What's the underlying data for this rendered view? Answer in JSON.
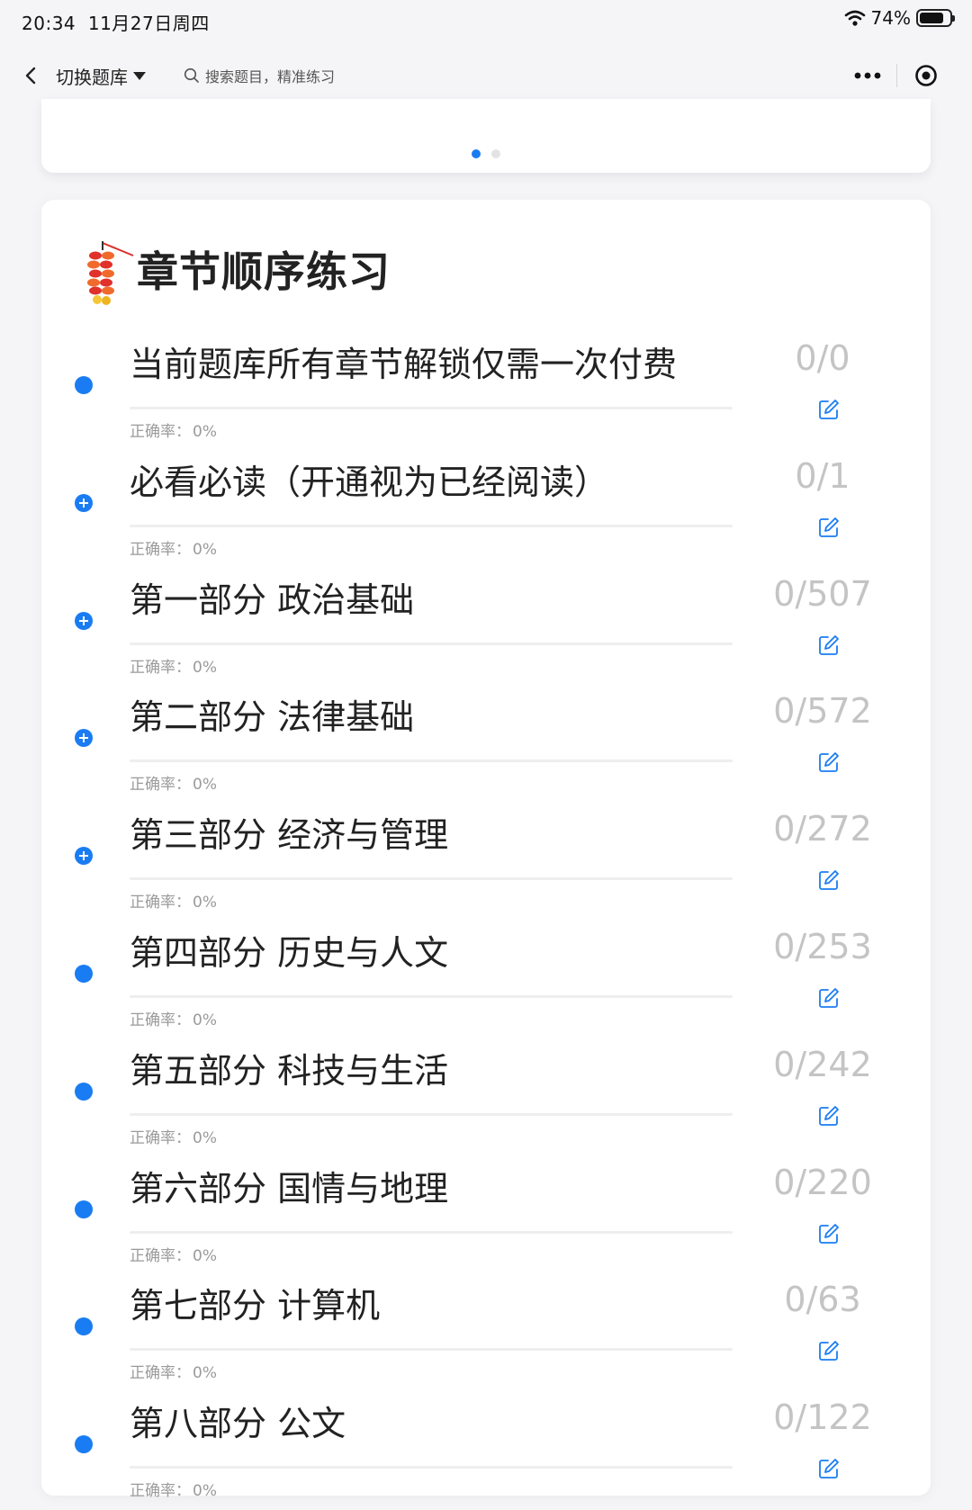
{
  "status_bar": {
    "time": "20:34",
    "date": "11月27日周四",
    "battery": "74%"
  },
  "nav": {
    "switch_bank": "切换题库",
    "search_placeholder": "搜索题目，精准练习"
  },
  "carousel": {
    "pages": 2,
    "active": 0
  },
  "section": {
    "title": "章节顺序练习"
  },
  "rate_label": "正确率：",
  "chapters": [
    {
      "title": "当前题库所有章节解锁仅需一次付费",
      "count": "0/0",
      "rate": "0%",
      "marker": "dot"
    },
    {
      "title": "必看必读（开通视为已经阅读）",
      "count": "0/1",
      "rate": "0%",
      "marker": "plus"
    },
    {
      "title": "第一部分 政治基础",
      "count": "0/507",
      "rate": "0%",
      "marker": "plus"
    },
    {
      "title": "第二部分 法律基础",
      "count": "0/572",
      "rate": "0%",
      "marker": "plus"
    },
    {
      "title": "第三部分 经济与管理",
      "count": "0/272",
      "rate": "0%",
      "marker": "plus"
    },
    {
      "title": "第四部分 历史与人文",
      "count": "0/253",
      "rate": "0%",
      "marker": "dot"
    },
    {
      "title": "第五部分 科技与生活",
      "count": "0/242",
      "rate": "0%",
      "marker": "dot"
    },
    {
      "title": "第六部分 国情与地理",
      "count": "0/220",
      "rate": "0%",
      "marker": "dot"
    },
    {
      "title": "第七部分 计算机",
      "count": "0/63",
      "rate": "0%",
      "marker": "dot"
    },
    {
      "title": "第八部分 公文",
      "count": "0/122",
      "rate": "0%",
      "marker": "dot"
    }
  ],
  "colors": {
    "accent": "#1a7cf2",
    "count_text": "#c4c4c4",
    "rate_text": "#9a9a9a"
  }
}
